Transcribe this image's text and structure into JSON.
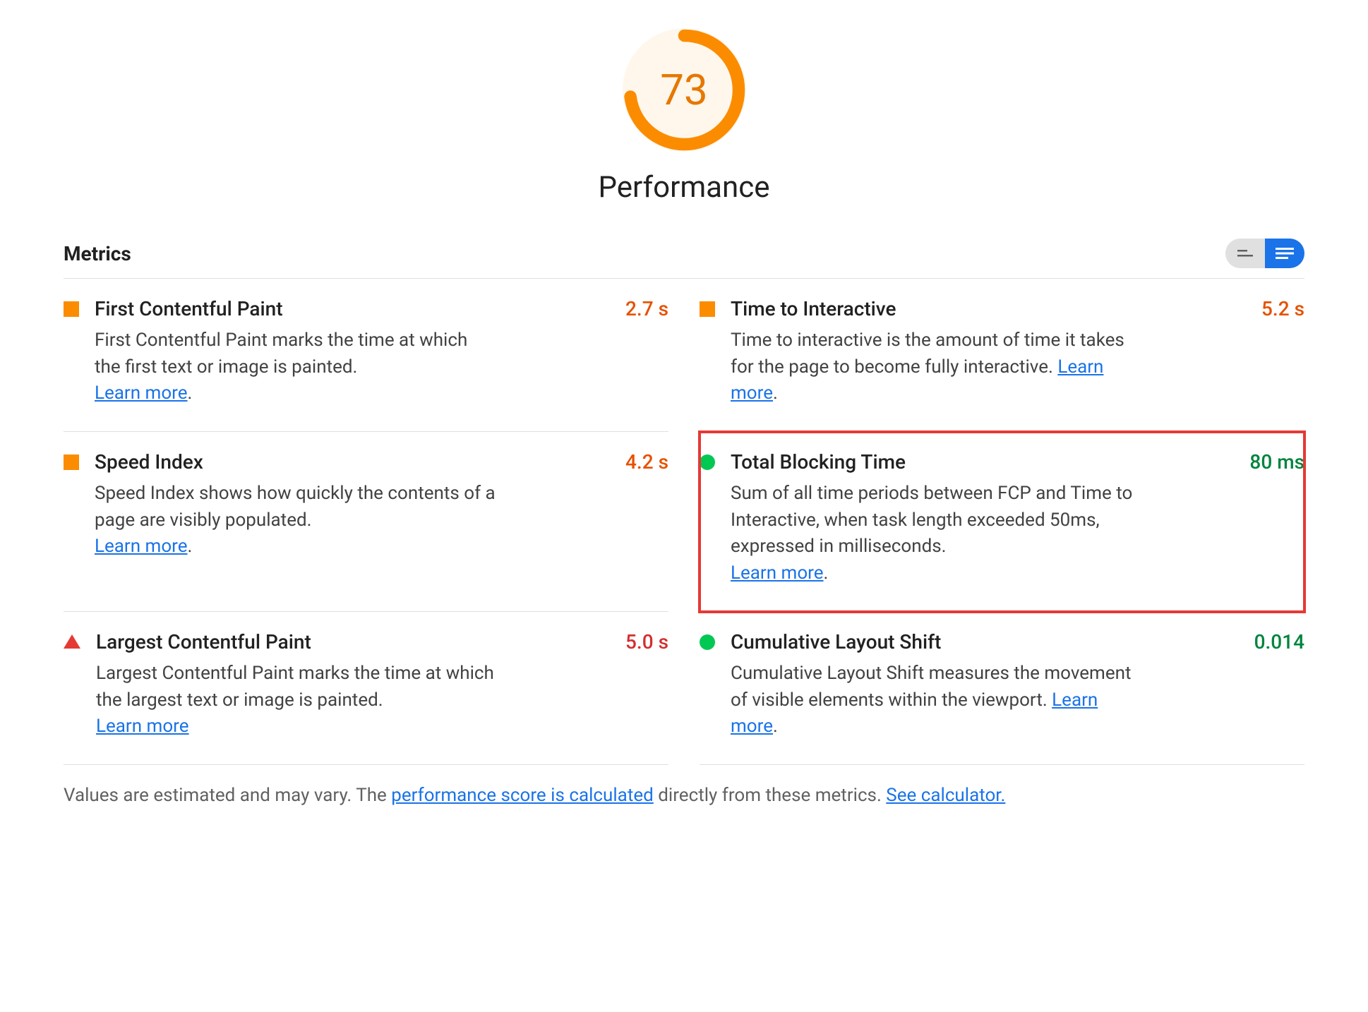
{
  "header": {
    "score": "73",
    "score_pct": 73,
    "title": "Performance",
    "gauge_color": "#FB8C00"
  },
  "section": {
    "label": "Metrics"
  },
  "learn_more": "Learn more",
  "metrics": [
    {
      "id": "fcp",
      "status": "average",
      "name": "First Contentful Paint",
      "value": "2.7 s",
      "value_class": "orange",
      "desc": "First Contentful Paint marks the time at which the first text or image is painted.",
      "learn_inline": false,
      "highlight": false
    },
    {
      "id": "tti",
      "status": "average",
      "name": "Time to Interactive",
      "value": "5.2 s",
      "value_class": "orange",
      "desc": "Time to interactive is the amount of time it takes for the page to become fully interactive.",
      "learn_inline": true,
      "highlight": false
    },
    {
      "id": "si",
      "status": "average",
      "name": "Speed Index",
      "value": "4.2 s",
      "value_class": "orange",
      "desc": "Speed Index shows how quickly the contents of a page are visibly populated.",
      "learn_inline": false,
      "highlight": false
    },
    {
      "id": "tbt",
      "status": "good",
      "name": "Total Blocking Time",
      "value": "80 ms",
      "value_class": "green",
      "desc": "Sum of all time periods between FCP and Time to Interactive, when task length exceeded 50ms, expressed in milliseconds.",
      "learn_inline": false,
      "highlight": true
    },
    {
      "id": "lcp",
      "status": "poor",
      "name": "Largest Contentful Paint",
      "value": "5.0 s",
      "value_class": "red",
      "desc": "Largest Contentful Paint marks the time at which the largest text or image is painted.",
      "learn_inline": false,
      "no_period": true,
      "highlight": false
    },
    {
      "id": "cls",
      "status": "good",
      "name": "Cumulative Layout Shift",
      "value": "0.014",
      "value_class": "green",
      "desc": "Cumulative Layout Shift measures the movement of visible elements within the viewport.",
      "learn_inline": true,
      "highlight": false
    }
  ],
  "footer": {
    "prefix": "Values are estimated and may vary. The ",
    "link1": "performance score is calculated",
    "mid": " directly from these metrics. ",
    "link2": "See calculator."
  }
}
